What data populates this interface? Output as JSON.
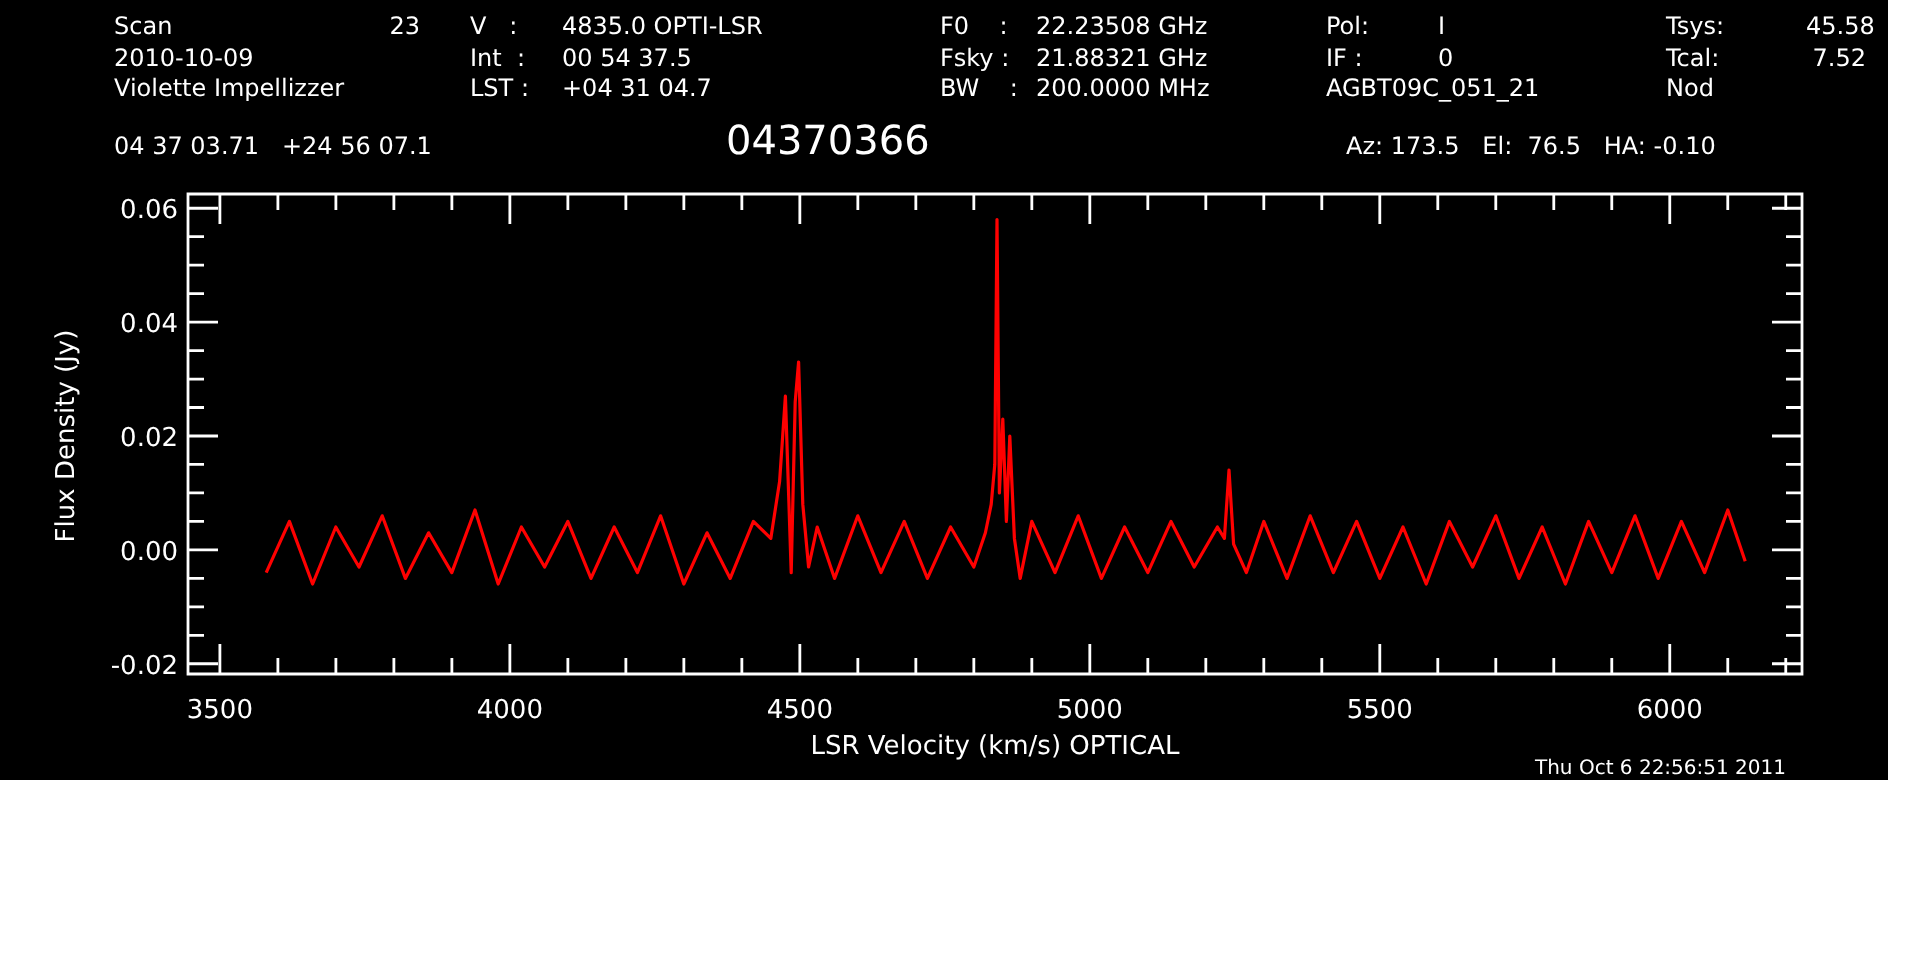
{
  "header": {
    "columns": [
      {
        "rows": [
          {
            "label": "Scan",
            "value": "23"
          },
          {
            "label": "2010-10-09"
          },
          {
            "label": "Violette Impellizzer"
          }
        ]
      },
      {
        "rows": [
          {
            "label": "V   :",
            "value": "4835.0 OPTI-LSR"
          },
          {
            "label": "Int  :",
            "value": "00 54 37.5"
          },
          {
            "label": "LST :",
            "value": "+04 31 04.7"
          }
        ]
      },
      {
        "rows": [
          {
            "label": "F0    :",
            "value": "22.23508 GHz"
          },
          {
            "label": "Fsky :",
            "value": "21.88321 GHz"
          },
          {
            "label": "BW    :",
            "value": "200.0000 MHz"
          }
        ]
      },
      {
        "rows": [
          {
            "label": "Pol:",
            "value": "I"
          },
          {
            "label": "IF :",
            "value": "0"
          },
          {
            "label": "AGBT09C_051_21"
          }
        ]
      },
      {
        "rows": [
          {
            "label": "Tsys:",
            "value": "45.58"
          },
          {
            "label": "Tcal:",
            "value": "7.52"
          },
          {
            "label": "Nod"
          }
        ]
      }
    ],
    "coordinates": "04 37 03.71   +24 56 07.1",
    "source": "04370366",
    "pointing": "Az: 173.5   El:  76.5   HA: -0.10"
  },
  "plot": {
    "chart_data": {
      "type": "line",
      "xlabel": "LSR Velocity (km/s) OPTICAL",
      "ylabel": "Flux Density (Jy)",
      "xlim": [
        3445,
        6228
      ],
      "ylim": [
        -0.0218,
        0.0625
      ],
      "xticks": [
        3500,
        4000,
        4500,
        5000,
        5500,
        6000
      ],
      "yticks": [
        {
          "value": -0.02,
          "label": "-0.02"
        },
        {
          "value": 0,
          "label": "0.00"
        },
        {
          "value": 0.02,
          "label": "0.02"
        },
        {
          "value": 0.04,
          "label": "0.04"
        },
        {
          "value": 0.06,
          "label": "0.06"
        }
      ],
      "x": [
        3580,
        3620,
        3660,
        3700,
        3740,
        3780,
        3820,
        3860,
        3900,
        3940,
        3980,
        4020,
        4060,
        4100,
        4140,
        4180,
        4220,
        4260,
        4300,
        4340,
        4380,
        4420,
        4450,
        4465,
        4475,
        4485,
        4492,
        4498,
        4505,
        4515,
        4530,
        4560,
        4600,
        4640,
        4680,
        4720,
        4760,
        4800,
        4820,
        4830,
        4836,
        4840,
        4844,
        4850,
        4856,
        4862,
        4870,
        4880,
        4900,
        4940,
        4980,
        5020,
        5060,
        5100,
        5140,
        5180,
        5220,
        5232,
        5240,
        5248,
        5270,
        5300,
        5340,
        5380,
        5420,
        5460,
        5500,
        5540,
        5580,
        5620,
        5660,
        5700,
        5740,
        5780,
        5820,
        5860,
        5900,
        5940,
        5980,
        6020,
        6060,
        6100,
        6130
      ],
      "series": [
        {
          "color": "#ff0000",
          "values": [
            -0.004,
            0.005,
            -0.006,
            0.004,
            -0.003,
            0.006,
            -0.005,
            0.003,
            -0.004,
            0.007,
            -0.006,
            0.004,
            -0.003,
            0.005,
            -0.005,
            0.004,
            -0.004,
            0.006,
            -0.006,
            0.003,
            -0.005,
            0.005,
            0.002,
            0.012,
            0.027,
            -0.004,
            0.026,
            0.033,
            0.008,
            -0.003,
            0.004,
            -0.005,
            0.006,
            -0.004,
            0.005,
            -0.005,
            0.004,
            -0.003,
            0.003,
            0.008,
            0.015,
            0.058,
            0.01,
            0.023,
            0.005,
            0.02,
            0.002,
            -0.005,
            0.005,
            -0.004,
            0.006,
            -0.005,
            0.004,
            -0.004,
            0.005,
            -0.003,
            0.004,
            0.002,
            0.014,
            0.001,
            -0.004,
            0.005,
            -0.005,
            0.006,
            -0.004,
            0.005,
            -0.005,
            0.004,
            -0.006,
            0.005,
            -0.003,
            0.006,
            -0.005,
            0.004,
            -0.006,
            0.005,
            -0.004,
            0.006,
            -0.005,
            0.005,
            -0.004,
            0.007,
            -0.002
          ]
        }
      ]
    }
  },
  "timestamp": "Thu Oct  6 22:56:51 2011"
}
